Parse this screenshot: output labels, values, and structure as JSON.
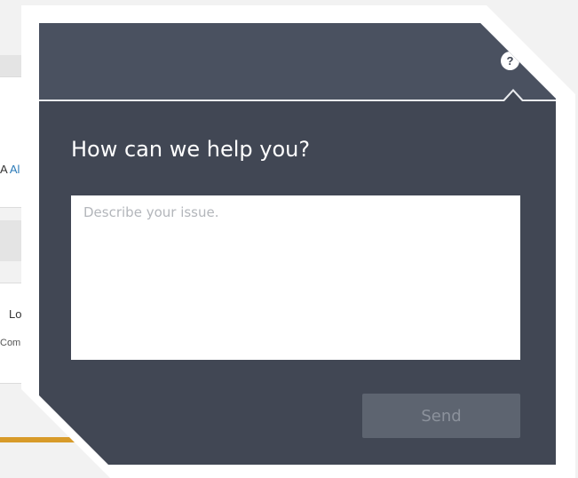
{
  "background": {
    "link_fragment": "Al",
    "prefix_glyph": "A",
    "text_fragment_1": "Lo",
    "text_fragment_2": "Com"
  },
  "help_panel": {
    "help_icon_glyph": "?",
    "title": "How can we help you?",
    "issue_field": {
      "placeholder": "Describe your issue.",
      "value": ""
    },
    "send_label": "Send"
  },
  "colors": {
    "panel_background": "#414754",
    "panel_header": "#4a5160",
    "send_button_disabled": "#5d6470",
    "accent_orange": "#d89b2a",
    "link_blue": "#2a7ab8"
  }
}
